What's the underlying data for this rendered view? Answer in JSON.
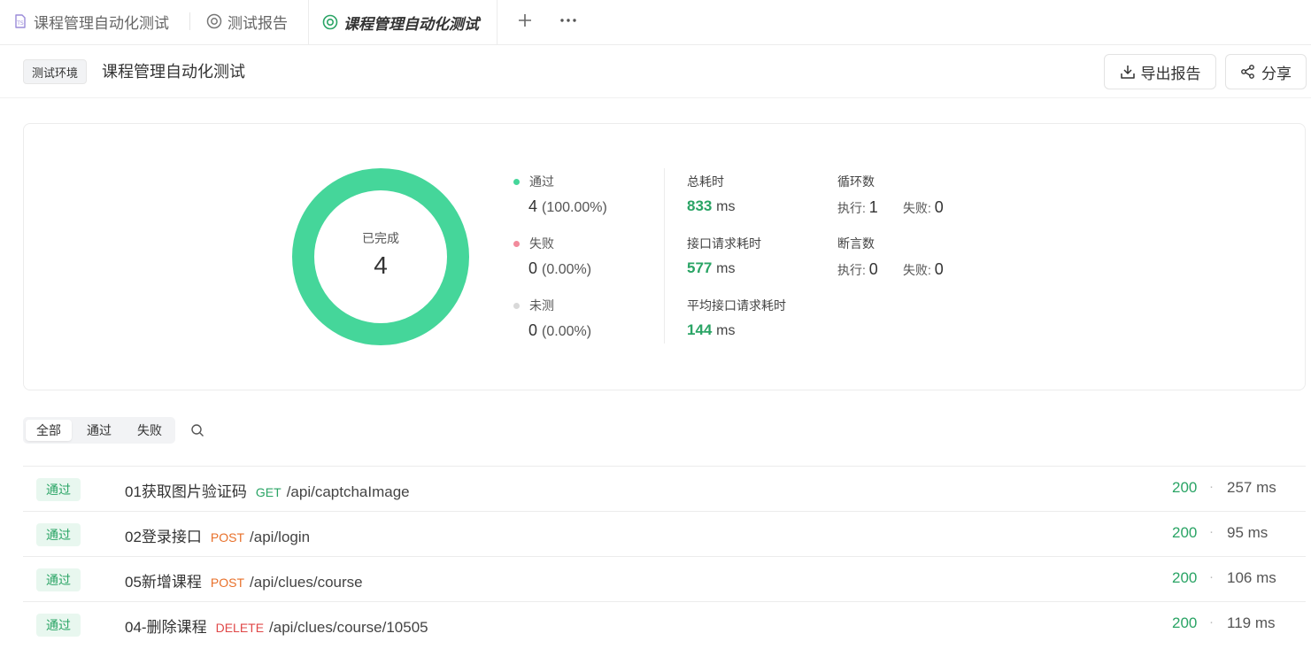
{
  "tabs": [
    {
      "label": "课程管理自动化测试",
      "icon": "test-suite-icon"
    },
    {
      "label": "测试报告",
      "icon": "report-icon"
    },
    {
      "label": "课程管理自动化测试",
      "icon": "report-active-icon"
    }
  ],
  "header": {
    "env_badge": "测试环境",
    "title": "课程管理自动化测试",
    "export_label": "导出报告",
    "share_label": "分享"
  },
  "summary": {
    "completed_label": "已完成",
    "completed_count": "4",
    "colors": {
      "pass": "#45d69a",
      "fail": "#f28b9c",
      "untested": "#d9d9d9",
      "accent": "#2aa465"
    },
    "stats": [
      {
        "label": "通过",
        "count": "4",
        "pct": "(100.00%)"
      },
      {
        "label": "失败",
        "count": "0",
        "pct": "(0.00%)"
      },
      {
        "label": "未测",
        "count": "0",
        "pct": "(0.00%)"
      }
    ],
    "metrics": [
      {
        "label": "总耗时",
        "value": "833",
        "unit": "ms"
      },
      {
        "label": "接口请求耗时",
        "value": "577",
        "unit": "ms"
      },
      {
        "label": "平均接口请求耗时",
        "value": "144",
        "unit": "ms"
      }
    ],
    "loops": {
      "label": "循环数",
      "exec_label": "执行:",
      "exec": "1",
      "fail_label": "失败:",
      "fail": "0"
    },
    "asserts": {
      "label": "断言数",
      "exec_label": "执行:",
      "exec": "0",
      "fail_label": "失败:",
      "fail": "0"
    }
  },
  "filter": {
    "all": "全部",
    "pass": "通过",
    "fail": "失败"
  },
  "rows": [
    {
      "status": "通过",
      "name": "01获取图片验证码",
      "method": "GET",
      "method_color": "#2aa465",
      "path": "/api/captchaImage",
      "code": "200",
      "sep": "·",
      "time": "257 ms"
    },
    {
      "status": "通过",
      "name": "02登录接口",
      "method": "POST",
      "method_color": "#e8702a",
      "path": "/api/login",
      "code": "200",
      "sep": "·",
      "time": "95 ms"
    },
    {
      "status": "通过",
      "name": "05新增课程",
      "method": "POST",
      "method_color": "#e8702a",
      "path": "/api/clues/course",
      "code": "200",
      "sep": "·",
      "time": "106 ms"
    },
    {
      "status": "通过",
      "name": "04-删除课程",
      "method": "DELETE",
      "method_color": "#e04848",
      "path": "/api/clues/course/10505",
      "code": "200",
      "sep": "·",
      "time": "119 ms"
    }
  ]
}
